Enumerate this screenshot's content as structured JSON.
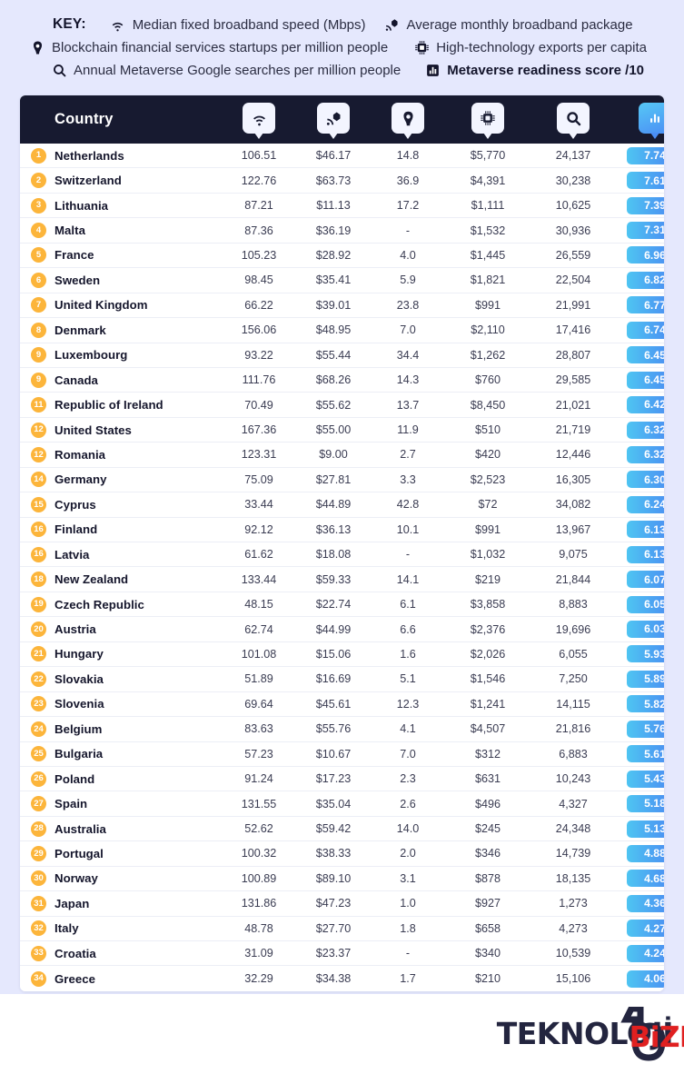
{
  "key": {
    "label": "KEY:",
    "items": [
      {
        "icon": "wifi-icon",
        "text": "Median fixed broadband speed (Mbps)",
        "bold": false
      },
      {
        "icon": "router-cost-icon",
        "text": "Average monthly broadband package",
        "bold": false
      },
      {
        "icon": "blockchain-icon",
        "text": "Blockchain financial services startups per million people",
        "bold": false
      },
      {
        "icon": "chip-icon",
        "text": "High-technology exports per capita",
        "bold": false
      },
      {
        "icon": "search-icon",
        "text": "Annual Metaverse Google searches per million people",
        "bold": false
      },
      {
        "icon": "bar-chart-icon",
        "text": "Metaverse readiness score /10",
        "bold": true
      }
    ]
  },
  "table": {
    "country_header": "Country",
    "column_icons": [
      "wifi-icon",
      "router-cost-icon",
      "blockchain-icon",
      "chip-icon",
      "search-icon",
      "bar-chart-icon"
    ],
    "colors": {
      "header_bg": "#171a30",
      "rank_circle": "#fcb53b",
      "badge_gradient_from": "#4ec5f2",
      "badge_gradient_to": "#4b7df2",
      "page_bg": "#e5e8fd"
    },
    "rows": [
      {
        "rank": "1",
        "country": "Netherlands",
        "speed": "106.51",
        "package": "$46.17",
        "blockchain": "14.8",
        "exports": "$5,770",
        "searches": "24,137",
        "score": "7.74"
      },
      {
        "rank": "2",
        "country": "Switzerland",
        "speed": "122.76",
        "package": "$63.73",
        "blockchain": "36.9",
        "exports": "$4,391",
        "searches": "30,238",
        "score": "7.61"
      },
      {
        "rank": "3",
        "country": "Lithuania",
        "speed": "87.21",
        "package": "$11.13",
        "blockchain": "17.2",
        "exports": "$1,111",
        "searches": "10,625",
        "score": "7.39"
      },
      {
        "rank": "4",
        "country": "Malta",
        "speed": "87.36",
        "package": "$36.19",
        "blockchain": "-",
        "exports": "$1,532",
        "searches": "30,936",
        "score": "7.31"
      },
      {
        "rank": "5",
        "country": "France",
        "speed": "105.23",
        "package": "$28.92",
        "blockchain": "4.0",
        "exports": "$1,445",
        "searches": "26,559",
        "score": "6.96"
      },
      {
        "rank": "6",
        "country": "Sweden",
        "speed": "98.45",
        "package": "$35.41",
        "blockchain": "5.9",
        "exports": "$1,821",
        "searches": "22,504",
        "score": "6.82"
      },
      {
        "rank": "7",
        "country": "United Kingdom",
        "speed": "66.22",
        "package": "$39.01",
        "blockchain": "23.8",
        "exports": "$991",
        "searches": "21,991",
        "score": "6.77"
      },
      {
        "rank": "8",
        "country": "Denmark",
        "speed": "156.06",
        "package": "$48.95",
        "blockchain": "7.0",
        "exports": "$2,110",
        "searches": "17,416",
        "score": "6.74"
      },
      {
        "rank": "9",
        "country": "Luxembourg",
        "speed": "93.22",
        "package": "$55.44",
        "blockchain": "34.4",
        "exports": "$1,262",
        "searches": "28,807",
        "score": "6.45"
      },
      {
        "rank": "9",
        "country": "Canada",
        "speed": "111.76",
        "package": "$68.26",
        "blockchain": "14.3",
        "exports": "$760",
        "searches": "29,585",
        "score": "6.45"
      },
      {
        "rank": "11",
        "country": "Republic of Ireland",
        "speed": "70.49",
        "package": "$55.62",
        "blockchain": "13.7",
        "exports": "$8,450",
        "searches": "21,021",
        "score": "6.42"
      },
      {
        "rank": "12",
        "country": "United States",
        "speed": "167.36",
        "package": "$55.00",
        "blockchain": "11.9",
        "exports": "$510",
        "searches": "21,719",
        "score": "6.32"
      },
      {
        "rank": "12",
        "country": "Romania",
        "speed": "123.31",
        "package": "$9.00",
        "blockchain": "2.7",
        "exports": "$420",
        "searches": "12,446",
        "score": "6.32"
      },
      {
        "rank": "14",
        "country": "Germany",
        "speed": "75.09",
        "package": "$27.81",
        "blockchain": "3.3",
        "exports": "$2,523",
        "searches": "16,305",
        "score": "6.30"
      },
      {
        "rank": "15",
        "country": "Cyprus",
        "speed": "33.44",
        "package": "$44.89",
        "blockchain": "42.8",
        "exports": "$72",
        "searches": "34,082",
        "score": "6.24"
      },
      {
        "rank": "16",
        "country": "Finland",
        "speed": "92.12",
        "package": "$36.13",
        "blockchain": "10.1",
        "exports": "$991",
        "searches": "13,967",
        "score": "6.13"
      },
      {
        "rank": "16",
        "country": "Latvia",
        "speed": "61.62",
        "package": "$18.08",
        "blockchain": "-",
        "exports": "$1,032",
        "searches": "9,075",
        "score": "6.13"
      },
      {
        "rank": "18",
        "country": "New Zealand",
        "speed": "133.44",
        "package": "$59.33",
        "blockchain": "14.1",
        "exports": "$219",
        "searches": "21,844",
        "score": "6.07"
      },
      {
        "rank": "19",
        "country": "Czech Republic",
        "speed": "48.15",
        "package": "$22.74",
        "blockchain": "6.1",
        "exports": "$3,858",
        "searches": "8,883",
        "score": "6.05"
      },
      {
        "rank": "20",
        "country": "Austria",
        "speed": "62.74",
        "package": "$44.99",
        "blockchain": "6.6",
        "exports": "$2,376",
        "searches": "19,696",
        "score": "6.03"
      },
      {
        "rank": "21",
        "country": "Hungary",
        "speed": "101.08",
        "package": "$15.06",
        "blockchain": "1.6",
        "exports": "$2,026",
        "searches": "6,055",
        "score": "5.93"
      },
      {
        "rank": "22",
        "country": "Slovakia",
        "speed": "51.89",
        "package": "$16.69",
        "blockchain": "5.1",
        "exports": "$1,546",
        "searches": "7,250",
        "score": "5.89"
      },
      {
        "rank": "23",
        "country": "Slovenia",
        "speed": "69.64",
        "package": "$45.61",
        "blockchain": "12.3",
        "exports": "$1,241",
        "searches": "14,115",
        "score": "5.82"
      },
      {
        "rank": "24",
        "country": "Belgium",
        "speed": "83.63",
        "package": "$55.76",
        "blockchain": "4.1",
        "exports": "$4,507",
        "searches": "21,816",
        "score": "5.76"
      },
      {
        "rank": "25",
        "country": "Bulgaria",
        "speed": "57.23",
        "package": "$10.67",
        "blockchain": "7.0",
        "exports": "$312",
        "searches": "6,883",
        "score": "5.61"
      },
      {
        "rank": "26",
        "country": "Poland",
        "speed": "91.24",
        "package": "$17.23",
        "blockchain": "2.3",
        "exports": "$631",
        "searches": "10,243",
        "score": "5.43"
      },
      {
        "rank": "27",
        "country": "Spain",
        "speed": "131.55",
        "package": "$35.04",
        "blockchain": "2.6",
        "exports": "$496",
        "searches": "4,327",
        "score": "5.18"
      },
      {
        "rank": "28",
        "country": "Australia",
        "speed": "52.62",
        "package": "$59.42",
        "blockchain": "14.0",
        "exports": "$245",
        "searches": "24,348",
        "score": "5.13"
      },
      {
        "rank": "29",
        "country": "Portugal",
        "speed": "100.32",
        "package": "$38.33",
        "blockchain": "2.0",
        "exports": "$346",
        "searches": "14,739",
        "score": "4.88"
      },
      {
        "rank": "30",
        "country": "Norway",
        "speed": "100.89",
        "package": "$89.10",
        "blockchain": "3.1",
        "exports": "$878",
        "searches": "18,135",
        "score": "4.68"
      },
      {
        "rank": "31",
        "country": "Japan",
        "speed": "131.86",
        "package": "$47.23",
        "blockchain": "1.0",
        "exports": "$927",
        "searches": "1,273",
        "score": "4.36"
      },
      {
        "rank": "32",
        "country": "Italy",
        "speed": "48.78",
        "package": "$27.70",
        "blockchain": "1.8",
        "exports": "$658",
        "searches": "4,273",
        "score": "4.27"
      },
      {
        "rank": "33",
        "country": "Croatia",
        "speed": "31.09",
        "package": "$23.37",
        "blockchain": "-",
        "exports": "$340",
        "searches": "10,539",
        "score": "4.24"
      },
      {
        "rank": "34",
        "country": "Greece",
        "speed": "32.29",
        "package": "$34.38",
        "blockchain": "1.7",
        "exports": "$210",
        "searches": "15,106",
        "score": "4.06"
      }
    ]
  },
  "watermark": {
    "brand": "TEKNOLOJİ",
    "overlay": "BiZDEYiZ"
  }
}
